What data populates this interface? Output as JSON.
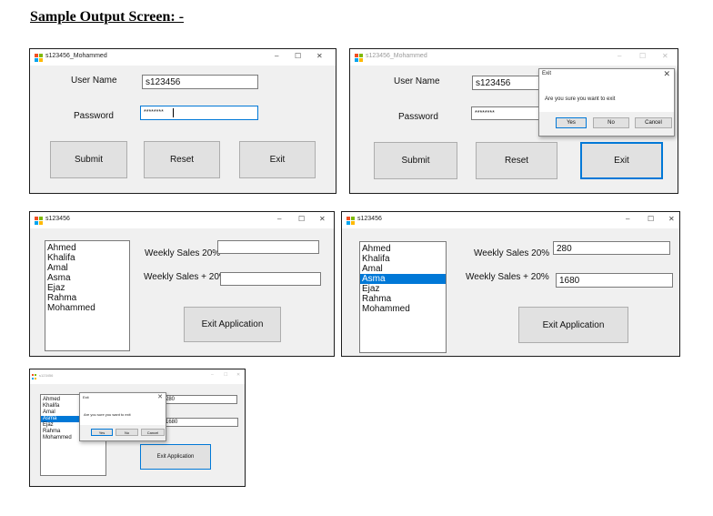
{
  "heading": "Sample Output Screen: -",
  "login": {
    "title": "s123456_Mohammed",
    "username_label": "User Name",
    "password_label": "Password",
    "username_value": "s123456",
    "password_value": "********",
    "submit": "Submit",
    "reset": "Reset",
    "exit": "Exit"
  },
  "controls": {
    "min": "–",
    "max": "☐",
    "close": "✕"
  },
  "exit_dialog": {
    "title": "Exit",
    "message": "Are you sure you want to exit",
    "yes": "Yes",
    "no": "No",
    "cancel": "Cancel"
  },
  "sales": {
    "title": "s123456",
    "names": [
      "Ahmed",
      "Khalifa",
      "Amal",
      "Asma",
      "Ejaz",
      "Rahma",
      "Mohammed"
    ],
    "selected_index": 3,
    "weekly_sales_label": "Weekly Sales 20%",
    "weekly_sales_plus_label": "Weekly Sales + 20%",
    "weekly_sales_value": "280",
    "weekly_sales_plus_value": "1680",
    "exit_button": "Exit Application"
  },
  "colors": {
    "accent": "#0078d7",
    "window_bg": "#f0f0f0",
    "button_bg": "#e1e1e1"
  }
}
